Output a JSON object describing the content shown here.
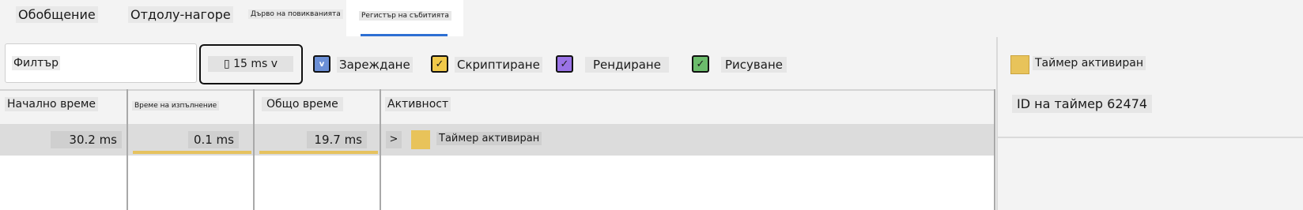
{
  "tabs": [
    {
      "label": "Обобщение"
    },
    {
      "label": "Отдолу-нагоре"
    },
    {
      "label": "Дърво на повикванията"
    },
    {
      "label": "Регистър на събитията"
    }
  ],
  "toolbar": {
    "filter_placeholder": "Филтър",
    "duration_value": "▯ 15 ms v",
    "checkboxes": [
      {
        "label": "Зареждане",
        "mark": "v",
        "color": "#6b8fd6"
      },
      {
        "label": "Скриптиране",
        "mark": "✓",
        "color": "#f0c94a"
      },
      {
        "label": "Рендиране",
        "mark": "✓",
        "color": "#9a73e6"
      },
      {
        "label": "Рисуване",
        "mark": "✓",
        "color": "#6cbc6c"
      }
    ]
  },
  "table": {
    "headers": [
      "Начално време",
      "Време на изпълнение",
      "Общо време",
      "Активност"
    ],
    "rows": [
      {
        "start": "30.2 ms",
        "self": "0.1 ms",
        "total": "19.7 ms",
        "expander": ">",
        "activity": "Таймер активиран",
        "activity_color": "#e8c35a"
      }
    ]
  },
  "details": {
    "title": "Таймер активиран",
    "title_color": "#e8c35a",
    "timer_id": "ID на таймер 62474"
  }
}
